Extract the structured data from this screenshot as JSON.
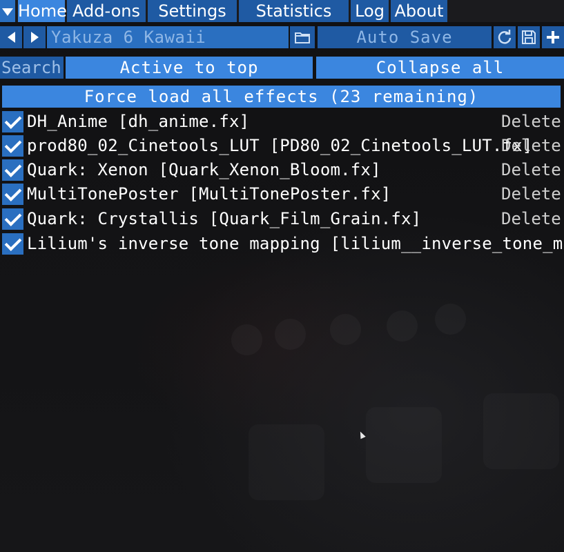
{
  "menu": {
    "tabs": [
      {
        "label": "Home",
        "active": true
      },
      {
        "label": "Add-ons",
        "active": false
      },
      {
        "label": "Settings",
        "active": false
      },
      {
        "label": "Statistics",
        "active": false
      },
      {
        "label": "Log",
        "active": false
      },
      {
        "label": "About",
        "active": false
      }
    ]
  },
  "toolbar": {
    "preset_name": "Yakuza 6 Kawaii",
    "auto_save_label": "Auto Save",
    "icons": [
      "chevron-left-icon",
      "chevron-right-icon",
      "folder-icon",
      "reload-icon",
      "save-icon",
      "plus-icon"
    ]
  },
  "search": {
    "label": "Search",
    "active_to_top_label": "Active to top",
    "collapse_all_label": "Collapse all"
  },
  "force_load_label": "Force load all effects (23 remaining)",
  "effects": [
    {
      "name": "DH_Anime [dh_anime.fx]",
      "checked": true,
      "delete_label": "Delete"
    },
    {
      "name": "prod80_02_Cinetools_LUT [PD80_02_Cinetools_LUT.fx]",
      "checked": true,
      "delete_label": "Delete"
    },
    {
      "name": "Quark: Xenon [Quark_Xenon_Bloom.fx]",
      "checked": true,
      "delete_label": "Delete"
    },
    {
      "name": "MultiTonePoster [MultiTonePoster.fx]",
      "checked": true,
      "delete_label": "Delete"
    },
    {
      "name": "Quark: Crystallis [Quark_Film_Grain.fx]",
      "checked": true,
      "delete_label": "Delete"
    },
    {
      "name": "Lilium's inverse tone mapping [lilium__inverse_tone_mapping.fx]",
      "checked": true,
      "delete_label": ""
    }
  ],
  "colors": {
    "accent": "#3b86df",
    "accent_dark": "#1f5aa3",
    "background": "#141416"
  }
}
